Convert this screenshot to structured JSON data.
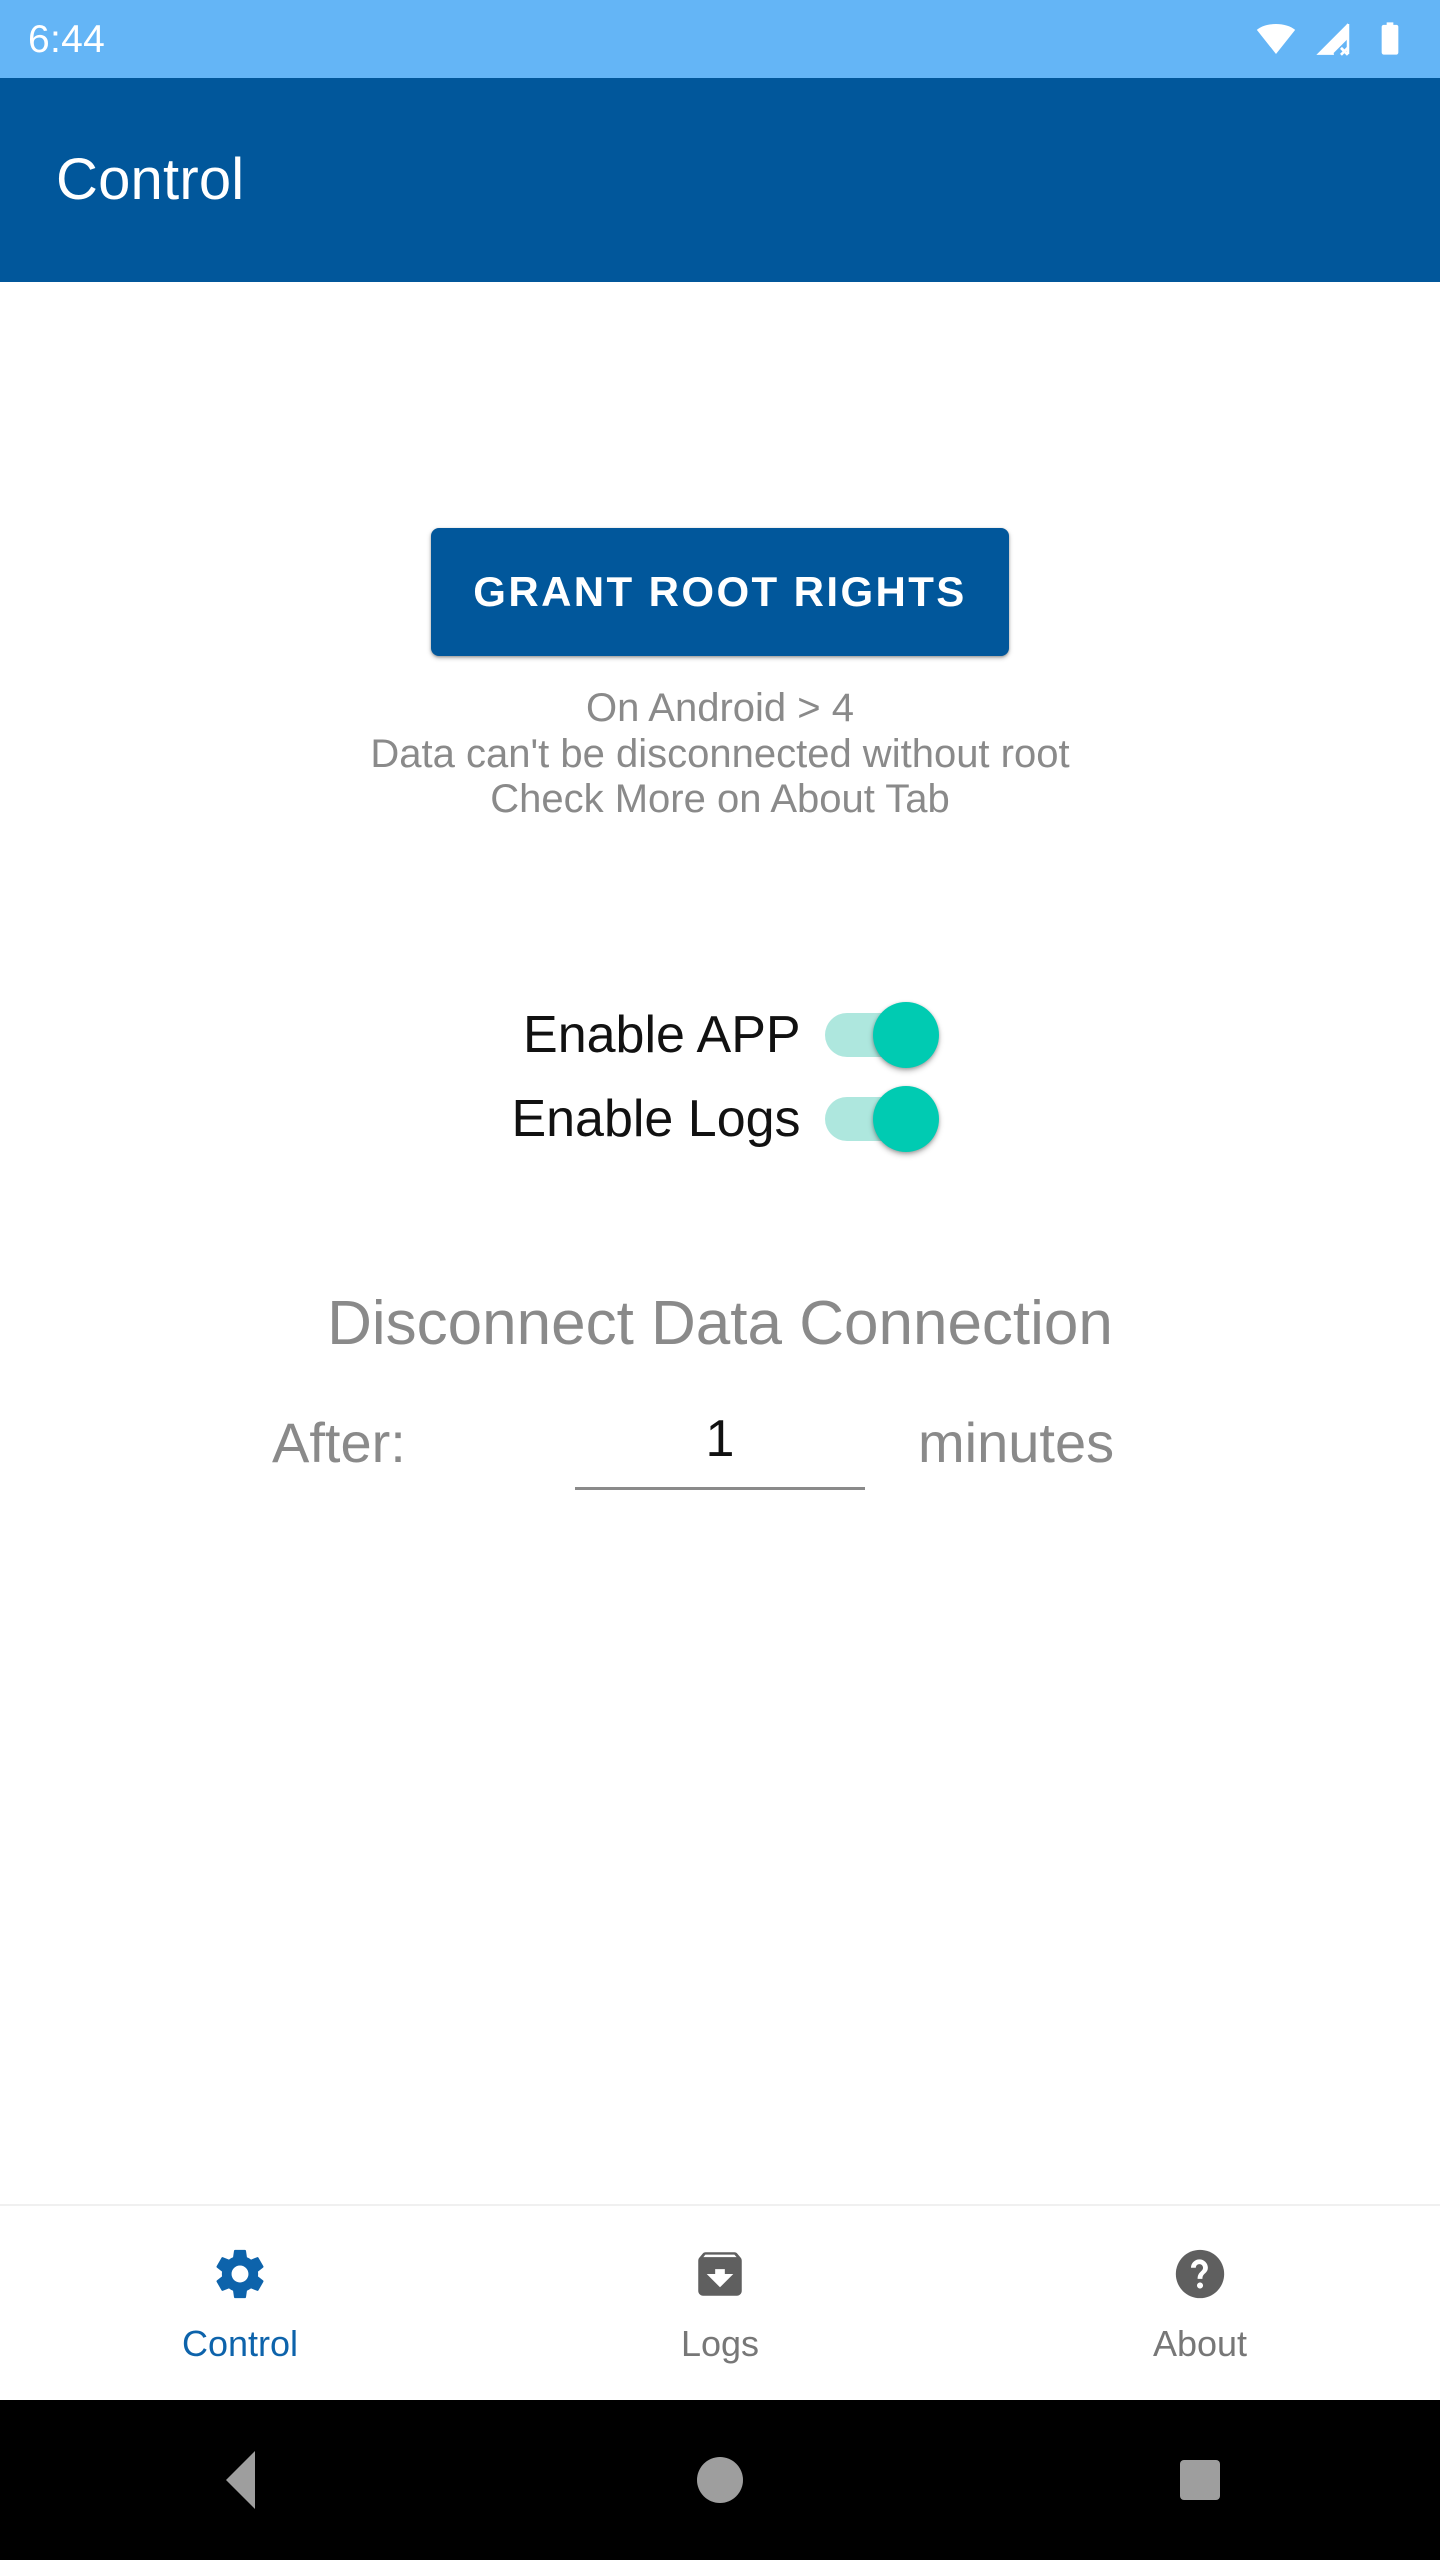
{
  "status_bar": {
    "time": "6:44",
    "icons": [
      {
        "name": "wifi-icon",
        "label": "wifi"
      },
      {
        "name": "cellular-off-icon",
        "label": "cellular-no-signal"
      },
      {
        "name": "battery-icon",
        "label": "battery-full"
      }
    ],
    "background": "#64B5F6"
  },
  "app_bar": {
    "title": "Control",
    "background": "#01579B"
  },
  "main": {
    "root_button": {
      "label": "GRANT ROOT RIGHTS",
      "background": "#01579B",
      "text_color": "#FFFFFF"
    },
    "hint_lines": [
      "On Android > 4",
      "Data can't be disconnected without root",
      "Check More on About Tab"
    ],
    "switches": [
      {
        "label": "Enable APP",
        "checked": true
      },
      {
        "label": "Enable Logs",
        "checked": true
      }
    ],
    "switch_colors": {
      "track_on": "#AEE7DE",
      "thumb_on": "#00CBB2"
    },
    "disconnect": {
      "title": "Disconnect Data Connection",
      "after_label": "After:",
      "value": "1",
      "placeholder": "1",
      "unit_label": "minutes"
    }
  },
  "bottom_nav": {
    "active_index": 0,
    "active_color": "#0D63AB",
    "inactive_color": "#777777",
    "items": [
      {
        "label": "Control",
        "icon": "gear-icon"
      },
      {
        "label": "Logs",
        "icon": "archive-download-icon"
      },
      {
        "label": "About",
        "icon": "question-circle-icon"
      }
    ]
  },
  "android_nav": {
    "buttons": [
      {
        "name": "back-button",
        "label": "Back"
      },
      {
        "name": "home-button",
        "label": "Home"
      },
      {
        "name": "recents-button",
        "label": "Recents"
      }
    ]
  }
}
